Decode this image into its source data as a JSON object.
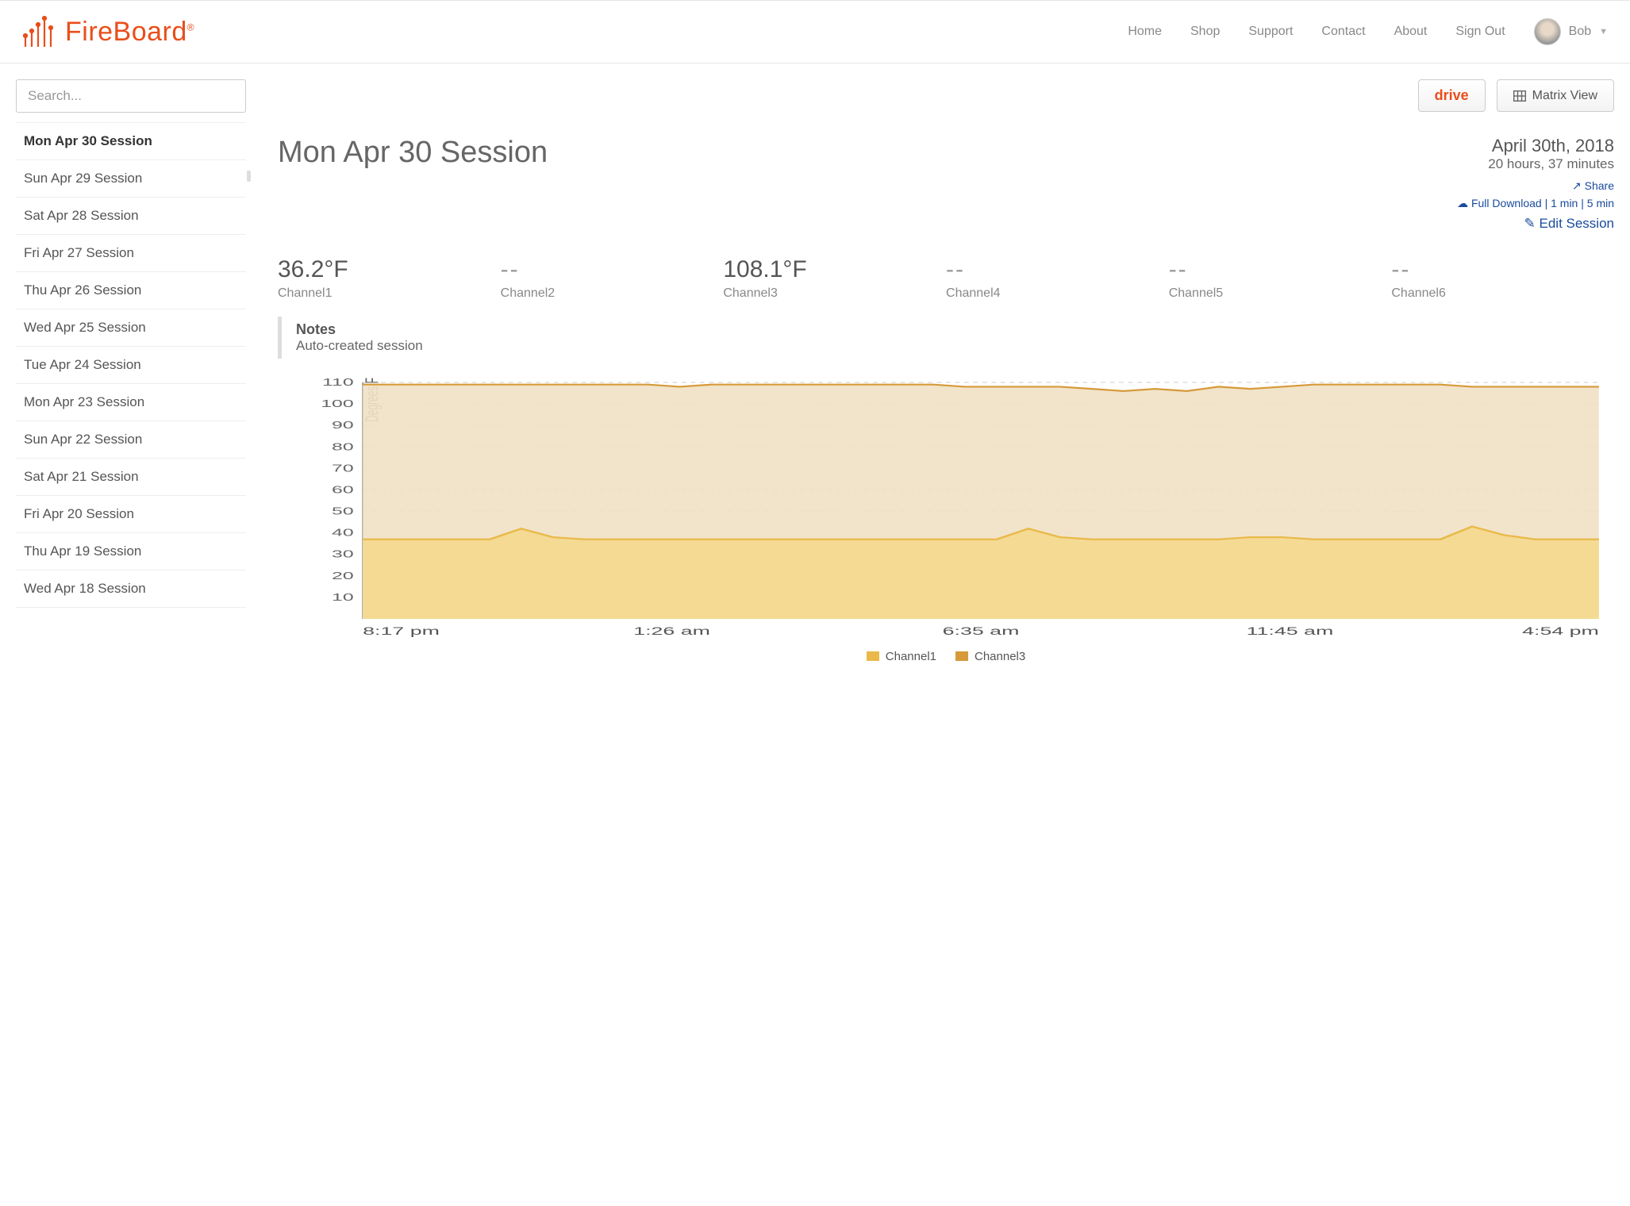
{
  "brand": "FireBoard",
  "nav": {
    "home": "Home",
    "shop": "Shop",
    "support": "Support",
    "contact": "Contact",
    "about": "About",
    "signout": "Sign Out"
  },
  "user": {
    "name": "Bob"
  },
  "actions": {
    "drive": "drive",
    "matrix": "Matrix View"
  },
  "search": {
    "placeholder": "Search..."
  },
  "sessions": [
    "Mon Apr 30 Session",
    "Sun Apr 29 Session",
    "Sat Apr 28 Session",
    "Fri Apr 27 Session",
    "Thu Apr 26 Session",
    "Wed Apr 25 Session",
    "Tue Apr 24 Session",
    "Mon Apr 23 Session",
    "Sun Apr 22 Session",
    "Sat Apr 21 Session",
    "Fri Apr 20 Session",
    "Thu Apr 19 Session",
    "Wed Apr 18 Session"
  ],
  "session": {
    "title": "Mon Apr 30 Session",
    "date": "April 30th, 2018",
    "duration": "20 hours, 37 minutes",
    "share": "Share",
    "full_dl": "Full Download",
    "dl_1": "1 min",
    "dl_5": "5 min",
    "edit": "Edit Session"
  },
  "channels": [
    {
      "value": "36.2°F",
      "label": "Channel1"
    },
    {
      "value": "--",
      "label": "Channel2"
    },
    {
      "value": "108.1°F",
      "label": "Channel3"
    },
    {
      "value": "--",
      "label": "Channel4"
    },
    {
      "value": "--",
      "label": "Channel5"
    },
    {
      "value": "--",
      "label": "Channel6"
    }
  ],
  "notes": {
    "title": "Notes",
    "body": "Auto-created session"
  },
  "legend": {
    "ch1": "Channel1",
    "ch3": "Channel3"
  },
  "chart_data": {
    "type": "line",
    "title": "",
    "xlabel": "",
    "ylabel": "Degrees F",
    "ylim": [
      0,
      110
    ],
    "x_ticks": [
      "8:17 pm",
      "1:26 am",
      "6:35 am",
      "11:45 am",
      "4:54 pm"
    ],
    "y_ticks": [
      10,
      20,
      30,
      40,
      50,
      60,
      70,
      80,
      90,
      100,
      110
    ],
    "series": [
      {
        "name": "Channel1",
        "color": "#e9b94a",
        "fill": "#f3d98f",
        "values": [
          37,
          37,
          37,
          37,
          37,
          42,
          38,
          37,
          37,
          37,
          37,
          37,
          37,
          37,
          37,
          37,
          37,
          37,
          37,
          37,
          37,
          42,
          38,
          37,
          37,
          37,
          37,
          37,
          38,
          38,
          37,
          37,
          37,
          37,
          37,
          43,
          39,
          37,
          37,
          37
        ]
      },
      {
        "name": "Channel3",
        "color": "#d69a3a",
        "fill": "#f1e1c4",
        "values": [
          109,
          109,
          109,
          109,
          109,
          109,
          109,
          109,
          109,
          109,
          108,
          109,
          109,
          109,
          109,
          109,
          109,
          109,
          109,
          108,
          108,
          108,
          108,
          107,
          106,
          107,
          106,
          108,
          107,
          108,
          109,
          109,
          109,
          109,
          109,
          108,
          108,
          108,
          108,
          108
        ]
      }
    ]
  }
}
